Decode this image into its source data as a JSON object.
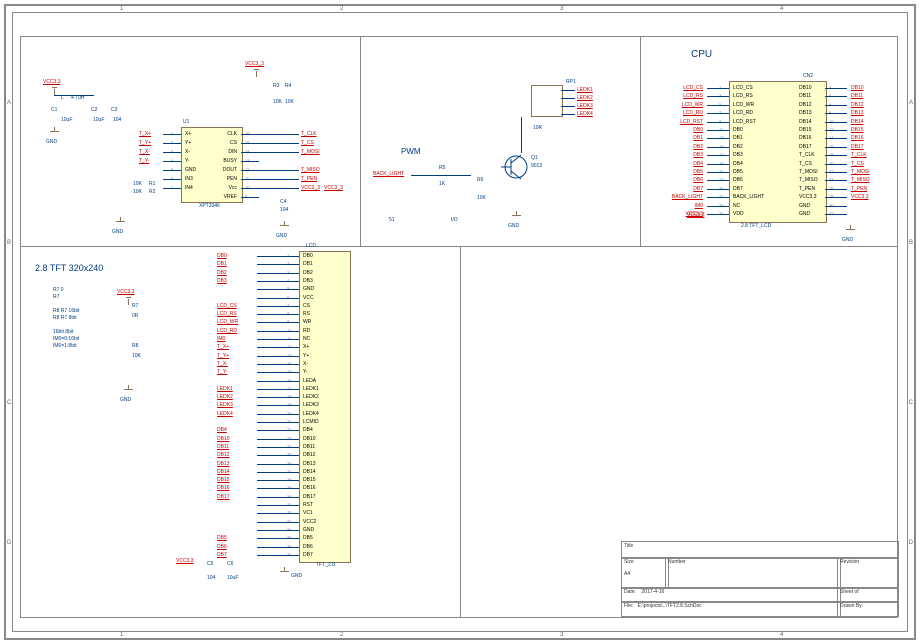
{
  "sheet": {
    "cols": [
      "1",
      "2",
      "3",
      "4"
    ],
    "rows": [
      "A",
      "B",
      "C",
      "D"
    ]
  },
  "tft": {
    "title": "2.8   TFT   320x240",
    "ref": "LCD",
    "part": "TFT_2.8",
    "pins": [
      "DB0",
      "DB1",
      "DB2",
      "DB3",
      "GND",
      "VCC",
      "CS",
      "RS",
      "WR",
      "RD",
      "NC",
      "X+",
      "Y+",
      "X-",
      "Y-",
      "LEDA",
      "LEDK1",
      "LEDK2",
      "LEDK3",
      "LEDK4",
      "LCMID",
      "DB4",
      "DB10",
      "DB11",
      "DB12",
      "DB13",
      "DB14",
      "DB15",
      "DB16",
      "DB17",
      "RST",
      "VC1",
      "VCC2",
      "GND",
      "DB5",
      "DB6",
      "DB7"
    ],
    "nets": [
      "DB0",
      "DB1",
      "DB2",
      "DB3",
      "",
      "",
      "LCD_CS",
      "LCD_RS",
      "LCD_WR",
      "LCD_RD",
      "IM0",
      "T_X+",
      "T_Y+",
      "T_X-",
      "T_Y-",
      "",
      "LEDK1",
      "LEDK2",
      "LEDK3",
      "LEDK4",
      "",
      "DB4",
      "DB10",
      "DB11",
      "DB12",
      "DB13",
      "DB14",
      "DB15",
      "DB16",
      "DB17",
      "",
      "",
      "",
      "",
      "DB5",
      "DB6",
      "DB7"
    ],
    "note1": "R7   0\nR7\n\nR8   R7   16bit\nR8   R7   8bit\n\n16bit   8bit\nIM0=0:16bit\nIM0=1:8bit",
    "r7": {
      "ref": "R7",
      "val": "0R"
    },
    "r8": {
      "ref": "R8",
      "val": "10K"
    },
    "c5": {
      "ref": "C5",
      "val": "104"
    },
    "c6": {
      "ref": "C6",
      "val": "10uF"
    },
    "vcc": "VCC3.3",
    "gnd": "GND"
  },
  "touch": {
    "u1": {
      "ref": "U1",
      "part": "XPT2046",
      "left": [
        "X+",
        "Y+",
        "X-",
        "Y-",
        "GND",
        "IN3",
        "IN4"
      ],
      "right": [
        "CLK",
        "CS",
        "DIN",
        "BUSY",
        "DOUT",
        "PEN",
        "Vcc",
        "VREF"
      ]
    },
    "c1": {
      "ref": "C1",
      "val": "10uF"
    },
    "c2": {
      "ref": "C2",
      "val": "10uF"
    },
    "c3": {
      "ref": "C3",
      "val": "104"
    },
    "c4": {
      "ref": "C4",
      "val": "104"
    },
    "l": {
      "ref": "L",
      "val": "4.7uH"
    },
    "r1": {
      "ref": "R1",
      "val": "10K"
    },
    "r2": {
      "ref": "R2",
      "val": "10K"
    },
    "r3": {
      "ref": "R3",
      "val": "10K"
    },
    "r4": {
      "ref": "R4",
      "val": "10K"
    },
    "vcc33": "VCC3.3",
    "vcc33b": "VCC3_3",
    "nets_in": [
      "T_X+",
      "T_Y+",
      "T_X-",
      "T_Y-"
    ],
    "nets_out": [
      "T_CLK",
      "T_CS",
      "T_MOSI",
      "",
      "T_MISO",
      "T_PEN",
      "VCC3_3",
      ""
    ]
  },
  "pwm": {
    "title": "PWM",
    "net": "BACK_LIGHT",
    "r5": {
      "ref": "R5",
      "val": "1K"
    },
    "r6": {
      "ref": "R6",
      "val": "10K"
    },
    "q1": {
      "ref": "Q1",
      "val": "9013"
    },
    "rp1": {
      "ref": "RP1",
      "val": "10R"
    },
    "leds": [
      "LEDK1",
      "LEDK2",
      "LEDK3",
      "LEDK4"
    ],
    "foot1": "51",
    "foot2": "I/O"
  },
  "cpu": {
    "title": "CPU",
    "ref": "CN2",
    "part": "2.8 TFT_LCD",
    "left_pins": [
      "LCD_CS",
      "LCD_RS",
      "LCD_WR",
      "LCD_RD",
      "LCD_RST",
      "DB0",
      "DB1",
      "DB2",
      "DB3",
      "DB4",
      "DB5",
      "DB6",
      "DB7",
      "BACK_LIGHT",
      "NC",
      "VDD"
    ],
    "right_pins": [
      "DB10",
      "DB11",
      "DB12",
      "DB13",
      "DB14",
      "DB15",
      "DB16",
      "DB17",
      "T_CLK",
      "T_CS",
      "T_MOSI",
      "T_MISO",
      "T_PEN",
      "VCC3.3",
      "GND",
      "GND"
    ],
    "left_nums": [
      "1",
      "3",
      "5",
      "7",
      "9",
      "11",
      "13",
      "15",
      "17",
      "19",
      "21",
      "23",
      "25",
      "27",
      "29",
      "31"
    ],
    "right_nums": [
      "2",
      "4",
      "6",
      "8",
      "10",
      "12",
      "14",
      "16",
      "18",
      "20",
      "22",
      "24",
      "26",
      "28",
      "30",
      "32"
    ],
    "left_nets": [
      "LCD_CS",
      "LCD_RS",
      "LCD_WR",
      "LCD_RD",
      "LCD_RST",
      "DB0",
      "DB1",
      "DB2",
      "DB3",
      "DB4",
      "DB5",
      "DB6",
      "DB7",
      "BACK_LIGHT",
      "IM0",
      "VCC3.3"
    ],
    "right_nets": [
      "DB10",
      "DB11",
      "DB12",
      "DB13",
      "DB14",
      "DB15",
      "DB16",
      "DB17",
      "T_CLK",
      "T_CS",
      "T_MOSI",
      "T_MISO",
      "T_PEN",
      "VCC3.3",
      "",
      ""
    ]
  },
  "titleblock": {
    "title": "Title",
    "size_lbl": "Size",
    "size": "A4",
    "number_lbl": "Number",
    "rev_lbl": "Revision",
    "date_lbl": "Date:",
    "date": "2017-4-16",
    "sheet_lbl": "Sheet    of",
    "file_lbl": "File:",
    "file": "E:\\projects\\..\\TFT2.8.SchDoc",
    "drawn_lbl": "Drawn By:"
  }
}
